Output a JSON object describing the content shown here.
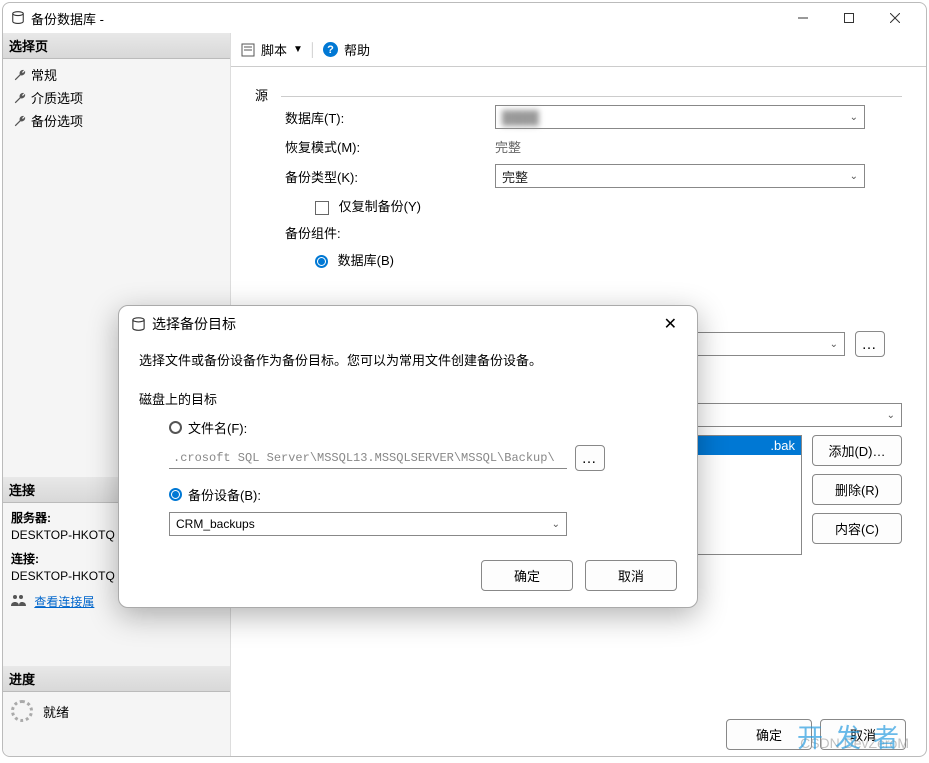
{
  "window": {
    "title": "备份数据库 - "
  },
  "sidebar": {
    "header_pages": "选择页",
    "items": [
      "常规",
      "介质选项",
      "备份选项"
    ],
    "header_conn": "连接",
    "server_label": "服务器:",
    "server_value": "DESKTOP-HKOTQ",
    "conn_label": "连接:",
    "conn_value": "DESKTOP-HKOTQ",
    "view_props": "查看连接属",
    "header_progress": "进度",
    "progress_text": "就绪"
  },
  "toolbar": {
    "script": "脚本",
    "help": "帮助"
  },
  "form": {
    "source_legend": "源",
    "db_label": "数据库(T):",
    "db_value": "████",
    "recovery_label": "恢复模式(M):",
    "recovery_value": "完整",
    "backup_type_label": "备份类型(K):",
    "backup_type_value": "完整",
    "copy_only": "仅复制备份(Y)",
    "component_label": "备份组件:",
    "component_db": "数据库(B)",
    "dest_item": ".bak",
    "add_btn": "添加(D)…",
    "remove_btn": "删除(R)",
    "content_btn": "内容(C)"
  },
  "modal": {
    "title": "选择备份目标",
    "desc": "选择文件或备份设备作为备份目标。您可以为常用文件创建备份设备。",
    "section": "磁盘上的目标",
    "file_label": "文件名(F):",
    "file_value": ".crosoft SQL Server\\MSSQL13.MSSQLSERVER\\MSSQL\\Backup\\",
    "device_label": "备份设备(B):",
    "device_value": "CRM_backups",
    "ok": "确定",
    "cancel": "取消"
  },
  "footer": {
    "ok": "确定",
    "cancel": "取消"
  },
  "watermark": {
    "main": "开发者",
    "sub": "CSDN DevZeroM"
  }
}
